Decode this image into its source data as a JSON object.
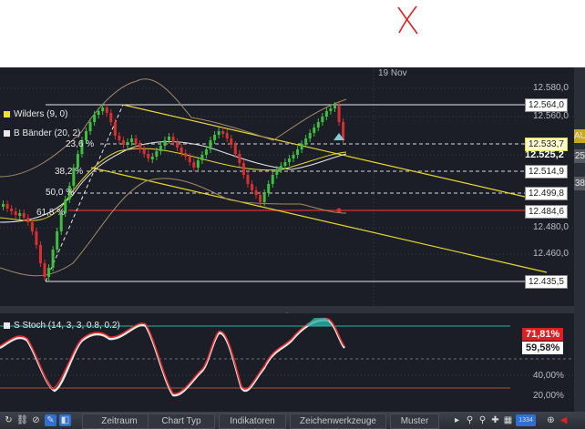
{
  "annotation": {
    "x_mark_color": "#e02020"
  },
  "chart": {
    "date_label": "19 Nov",
    "indicators": [
      {
        "label": "Wilders (9, 0)",
        "color": "#f0e030"
      },
      {
        "label": "B Bänder (20, 2)",
        "color": "#e9e9e9"
      }
    ],
    "fib_levels": [
      {
        "label": "23,6 %"
      },
      {
        "label": "38,2 %"
      },
      {
        "label": "50,0 %"
      },
      {
        "label": "61,8 %"
      }
    ],
    "price_boxes": [
      "12.564,0",
      "12.533,7",
      "12.514,9",
      "12.499,8",
      "12.484,6",
      "12.435,5"
    ],
    "axis_labels": [
      "12.580,0",
      "12.560,0",
      "12.525,2",
      "12.480,0",
      "12.460,0"
    ],
    "right_tabs": [
      "AU",
      "25",
      "38"
    ]
  },
  "stoch": {
    "label": "S Stoch (14, 3, 3, 0.8, 0.2)",
    "value_red": "71,81%",
    "value_white": "59,58%",
    "axis_labels": [
      "40,00%",
      "20,00%"
    ]
  },
  "toolbar": {
    "buttons": [
      "Zeitraum",
      "Chart Typ",
      "Indikatoren",
      "Zeichenwerkzeuge",
      "Muster"
    ],
    "icons": [
      "refresh-icon",
      "link-icon",
      "block-icon",
      "pencil-icon",
      "color-icon",
      "scroll-icon",
      "zoom-out-icon",
      "zoom-in-icon",
      "plus-icon",
      "grid-icon"
    ],
    "counter": "1334"
  }
}
